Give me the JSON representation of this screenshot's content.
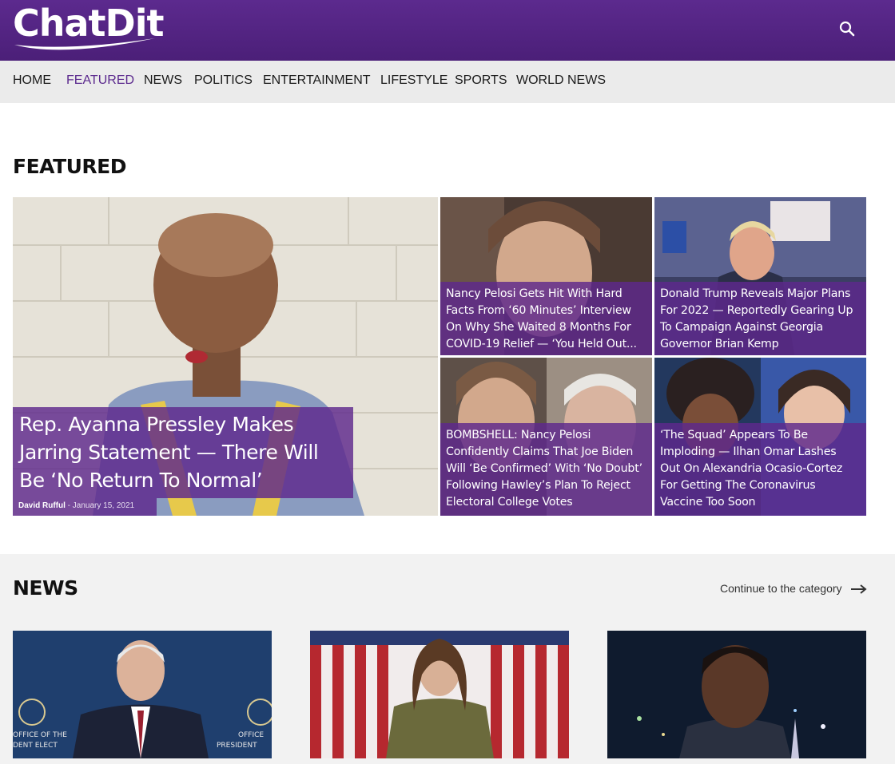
{
  "brand": {
    "name": "ChatDit",
    "primary_color": "#5c2a8e",
    "overlay_color": "#5e288c"
  },
  "header": {
    "search_icon": "search-icon"
  },
  "nav": {
    "items": [
      {
        "label": "HOME"
      },
      {
        "label": "FEATURED",
        "active": true
      },
      {
        "label": "NEWS"
      },
      {
        "label": "POLITICS"
      },
      {
        "label": "ENTERTAINMENT"
      },
      {
        "label": "LIFESTYLE"
      },
      {
        "label": "SPORTS"
      },
      {
        "label": "WORLD NEWS"
      }
    ]
  },
  "featured": {
    "title": "FEATURED",
    "main": {
      "headline_lines": [
        "Rep. Ayanna Pressley Makes",
        "Jarring Statement — There Will",
        "Be ‘No Return To Normal’"
      ],
      "author": "David Rufful",
      "separator": " - ",
      "date": "January 15, 2021"
    },
    "cards": [
      {
        "lines": [
          "Nancy Pelosi Gets Hit With Hard",
          "Facts From ‘60 Minutes’ Interview",
          "On Why She Waited 8 Months For",
          "COVID-19 Relief — ‘You Held Out..."
        ]
      },
      {
        "lines": [
          "Donald Trump Reveals Major Plans",
          "For 2022 — Reportedly Gearing Up",
          "To Campaign Against Georgia",
          "Governor Brian Kemp"
        ]
      },
      {
        "lines": [
          "BOMBSHELL: Nancy Pelosi",
          "Confidently Claims That Joe Biden",
          "Will ‘Be Confirmed’ With ‘No Doubt’",
          "Following Hawley’s Plan To Reject",
          "Electoral College Votes"
        ]
      },
      {
        "lines": [
          "‘The Squad’ Appears To Be",
          "Imploding — Ilhan Omar Lashes",
          "Out On Alexandria Ocasio-Cortez",
          "For Getting The Coronavirus",
          "Vaccine Too Soon"
        ]
      }
    ]
  },
  "news": {
    "title": "NEWS",
    "continue_label": "Continue to the category",
    "arrow_icon": "arrow-right-icon",
    "thumb1_caption_left": "OFFICE OF THE",
    "thumb1_caption_left2": "DENT ELECT",
    "thumb1_caption_right": "OFFICE",
    "thumb1_caption_right2": "PRESIDENT"
  }
}
